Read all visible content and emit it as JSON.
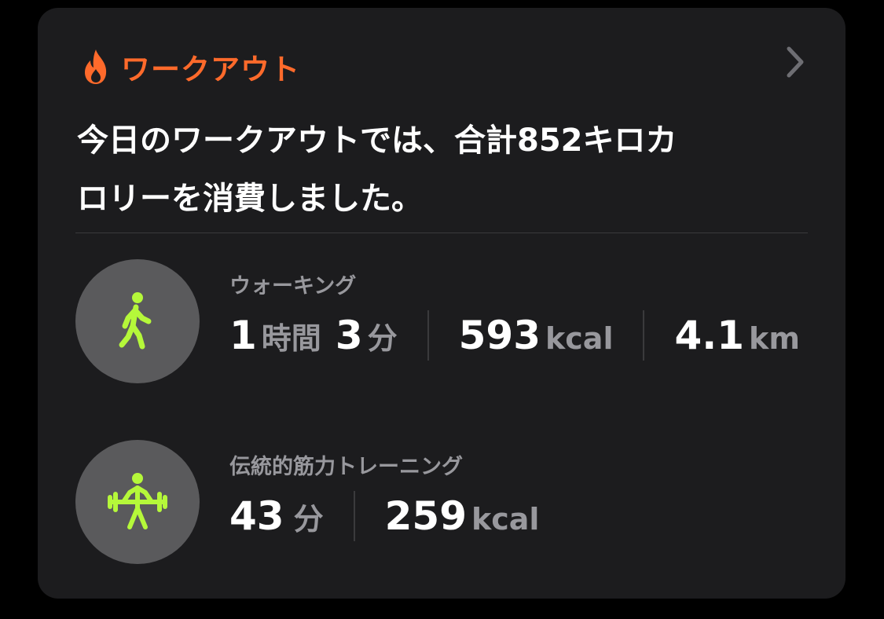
{
  "header": {
    "title": "ワークアウト",
    "accent_color": "#ff6a2b",
    "icon": "flame-icon",
    "chevron_icon": "chevron-right-icon"
  },
  "summary": {
    "line1": "今日のワークアウトでは、合計852キロカ",
    "line2": "ロリーを消費しました。"
  },
  "workouts": [
    {
      "name": "ウォーキング",
      "icon": "walking-figure-icon",
      "icon_color": "#b5f83a",
      "duration": {
        "hours": "1",
        "hours_unit": "時間",
        "minutes": "3",
        "minutes_unit": "分"
      },
      "calories": {
        "value": "593",
        "unit": "kcal"
      },
      "distance": {
        "value": "4.1",
        "unit": "km"
      }
    },
    {
      "name": "伝統的筋力トレーニング",
      "icon": "weightlifting-figure-icon",
      "icon_color": "#b5f83a",
      "duration": {
        "minutes": "43",
        "minutes_unit": "分"
      },
      "calories": {
        "value": "259",
        "unit": "kcal"
      }
    }
  ]
}
